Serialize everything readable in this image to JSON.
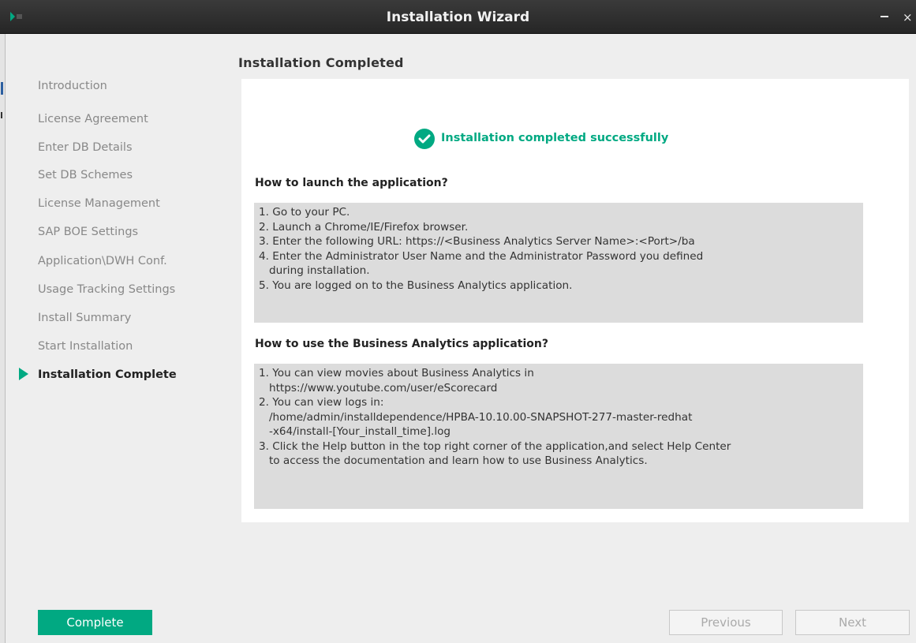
{
  "window": {
    "title": "Installation Wizard",
    "minimize_glyph": "_",
    "close_glyph": "×"
  },
  "page_title": "Installation Completed",
  "steps": [
    {
      "label": "Introduction",
      "active": false
    },
    {
      "label": "License Agreement",
      "active": false
    },
    {
      "label": "Enter DB Details",
      "active": false
    },
    {
      "label": "Set DB Schemes",
      "active": false
    },
    {
      "label": "License Management",
      "active": false
    },
    {
      "label": "SAP BOE Settings",
      "active": false
    },
    {
      "label": "Application\\DWH Conf.",
      "active": false
    },
    {
      "label": "Usage Tracking Settings",
      "active": false
    },
    {
      "label": "Install Summary",
      "active": false
    },
    {
      "label": "Start Installation",
      "active": false
    },
    {
      "label": "Installation Complete",
      "active": true
    }
  ],
  "success": {
    "icon": "check-circle-icon",
    "text": "Installation completed successfully"
  },
  "launch": {
    "heading": "How to launch the application?",
    "lines": [
      "1. Go to your PC.",
      "2. Launch a Chrome/IE/Firefox browser.",
      "3. Enter the following URL: https://<Business Analytics Server Name>:<Port>/ba",
      "4. Enter the Administrator User Name and the Administrator Password you defined",
      "   during installation.",
      "5. You are logged on to the Business Analytics application."
    ]
  },
  "usage": {
    "heading": "How to use the Business Analytics application?",
    "lines": [
      "1. You can view movies about Business Analytics in",
      "   https://www.youtube.com/user/eScorecard",
      "2. You can view logs in:",
      "   /home/admin/installdependence/HPBA-10.10.00-SNAPSHOT-277-master-redhat",
      "   -x64/install-[Your_install_time].log",
      "3. Click the Help button in the top right corner of the application,and select Help Center",
      "   to access the documentation and learn how to use Business Analytics."
    ]
  },
  "buttons": {
    "complete": "Complete",
    "previous": "Previous",
    "next": "Next"
  },
  "colors": {
    "accent": "#01a982",
    "titlebar": "#2b2b2b",
    "box_bg": "#dcdcdc",
    "disabled_text": "#aaaaaa"
  }
}
